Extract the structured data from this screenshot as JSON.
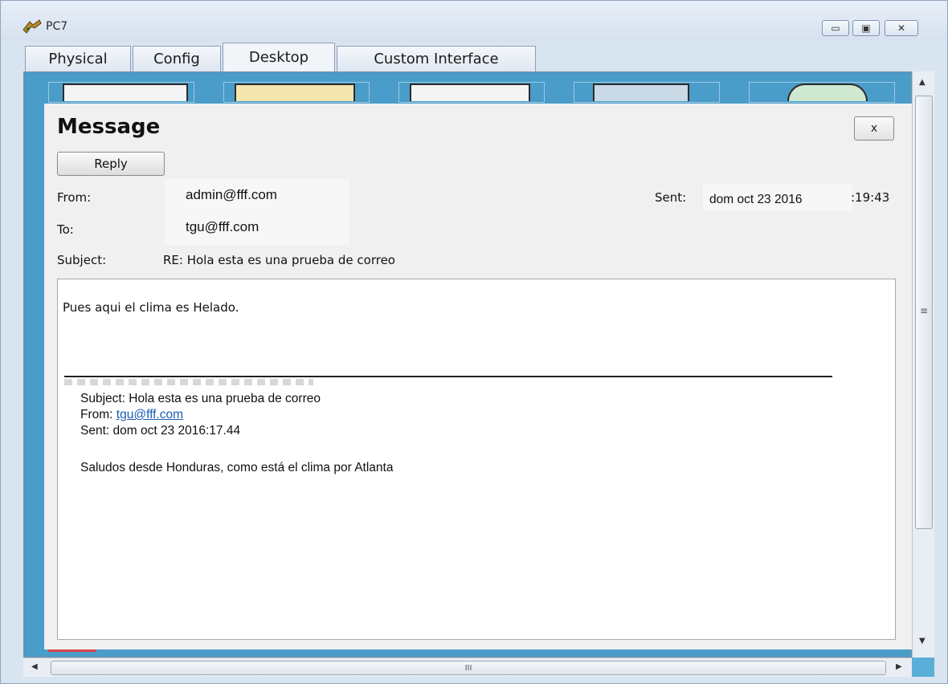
{
  "window": {
    "title": "PC7",
    "controls": [
      "▭",
      "▣",
      "✕"
    ]
  },
  "tabs": [
    {
      "label": "Physical"
    },
    {
      "label": "Config"
    },
    {
      "label": "Desktop"
    },
    {
      "label": "Custom Interface"
    }
  ],
  "message": {
    "title": "Message",
    "close_label": "x",
    "reply_label": "Reply",
    "from_label": "From:",
    "from_value": "admin@fff.com",
    "to_label": "To:",
    "to_value": "tgu@fff.com",
    "subject_label": "Subject:",
    "subject_value": "RE: Hola esta es una prueba de correo",
    "sent_label": "Sent:",
    "sent_date": "dom oct 23 2016",
    "sent_time": ":19:43",
    "body": "Pues aqui el clima es Helado.",
    "quoted": {
      "subject_line": "Subject: Hola esta es una prueba de correo",
      "from_prefix": "From: ",
      "from_link": "tgu@fff.com",
      "sent_line": "Sent: dom oct 23 2016:17.44",
      "body_line": "Saludos desde Honduras, como está el clima por Atlanta"
    }
  },
  "scrollbar": {
    "thumb_grip": "≡",
    "h_thumb_grip": "III"
  }
}
